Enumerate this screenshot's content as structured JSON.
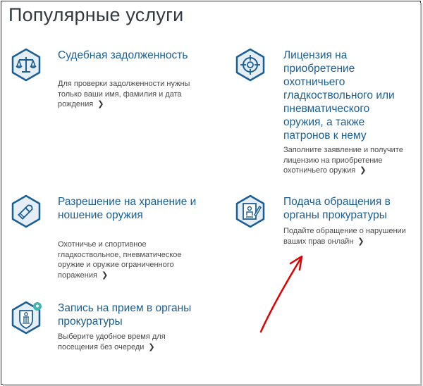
{
  "page": {
    "title": "Популярные услуги"
  },
  "services": [
    {
      "title": "Судебная задолженность",
      "description": "Для проверки задолженности нужны только ваши имя, фамилия и дата рождения",
      "icon": "scales-icon"
    },
    {
      "title": "Лицензия на приобретение охотничьего гладкоствольного или пневматического оружия, а также патронов к нему",
      "description": "Заполните заявление и получите лицензию на приобретение охотничьего оружия",
      "icon": "crosshair-icon"
    },
    {
      "title": "Разрешение на хранение и ношение оружия",
      "description": "Охотничье и спортивное гладкоствольное, пневматическое оружие и оружие ограниченного поражения",
      "icon": "bullet-icon"
    },
    {
      "title": "Подача обращения в органы прокуратуры",
      "description": "Подайте обращение о нарушении ваших прав онлайн",
      "icon": "document-edit-icon"
    },
    {
      "title": "Запись на прием в органы прокуратуры",
      "description": "Выберите удобное время для посещения без очереди",
      "icon": "emblem-location-icon"
    }
  ],
  "colors": {
    "link": "#1a5e96",
    "icon": "#1a5e96",
    "icon_bg": "#e6eef5",
    "arrow": "#e00000",
    "pin": "#43b4b0"
  }
}
